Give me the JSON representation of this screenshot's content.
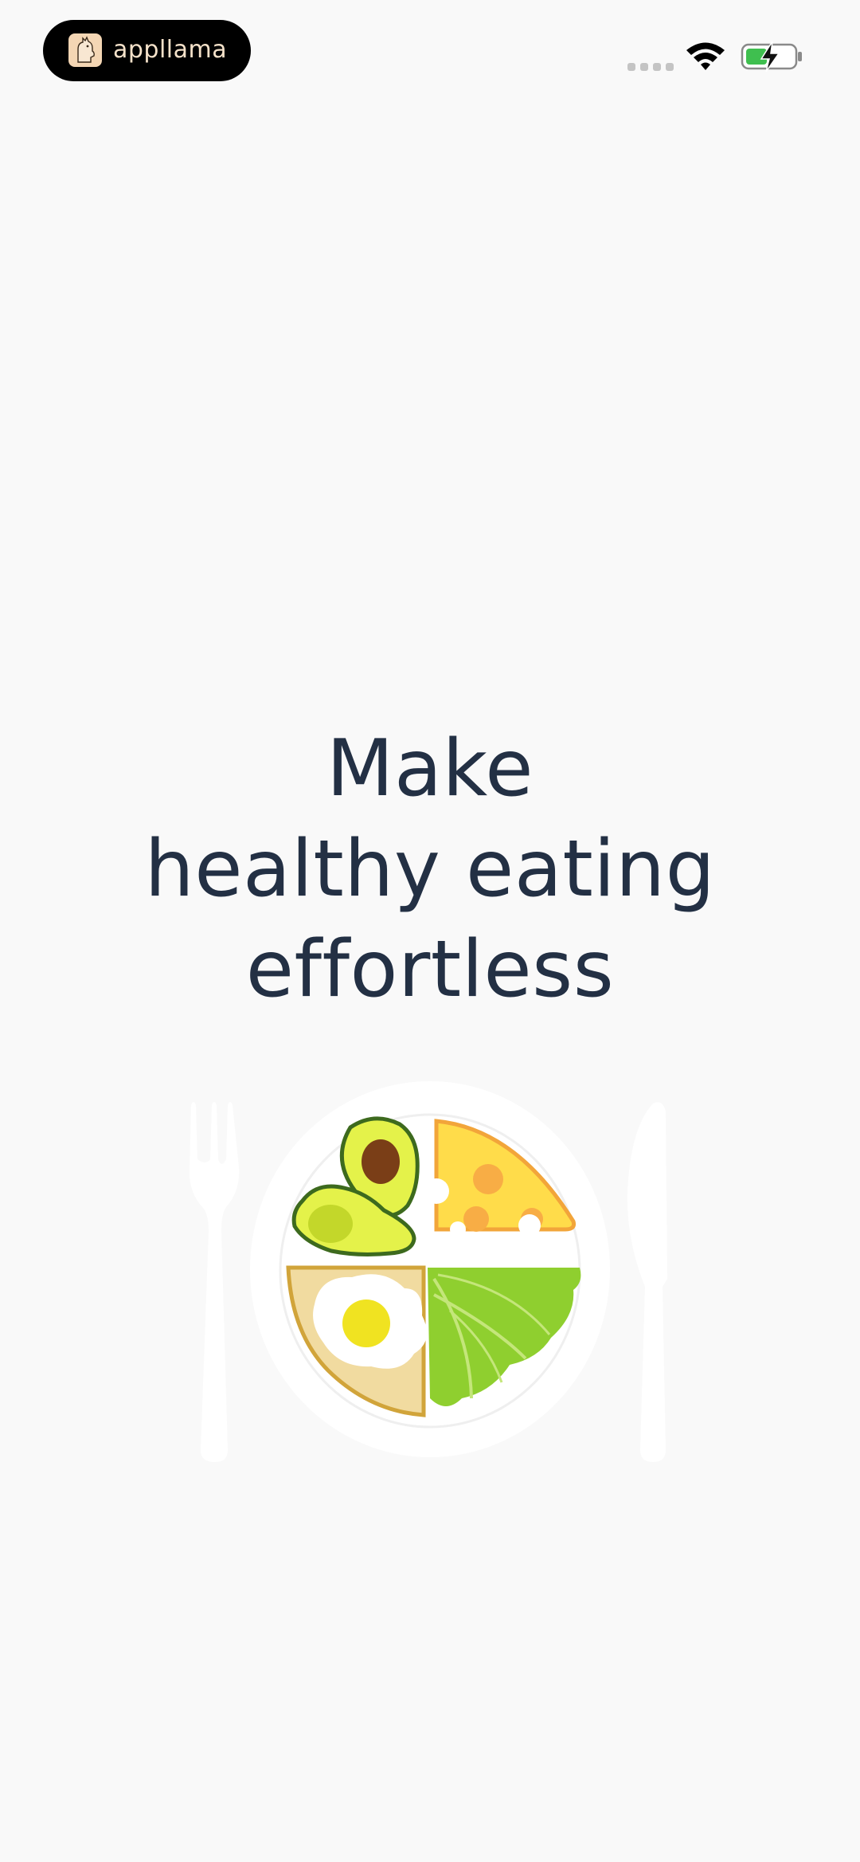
{
  "status_bar": {
    "app_badge": {
      "name": "appllama",
      "logo_icon": "llama-logo-icon"
    },
    "icons": [
      "signal-dots-icon",
      "wifi-icon",
      "battery-charging-icon"
    ],
    "battery_color": "#3fbf4f"
  },
  "main": {
    "headline_lines": [
      "Make",
      "healthy eating",
      "effortless"
    ]
  },
  "illustration": {
    "icons": [
      "fork-icon",
      "plate-icon",
      "avocado-icon",
      "cheese-icon",
      "fried-egg-toast-icon",
      "lettuce-icon",
      "knife-icon"
    ]
  },
  "colors": {
    "background": "#f9f9f9",
    "headline": "#233044",
    "badge_bg": "#000000",
    "badge_text": "#f4e1c9"
  }
}
